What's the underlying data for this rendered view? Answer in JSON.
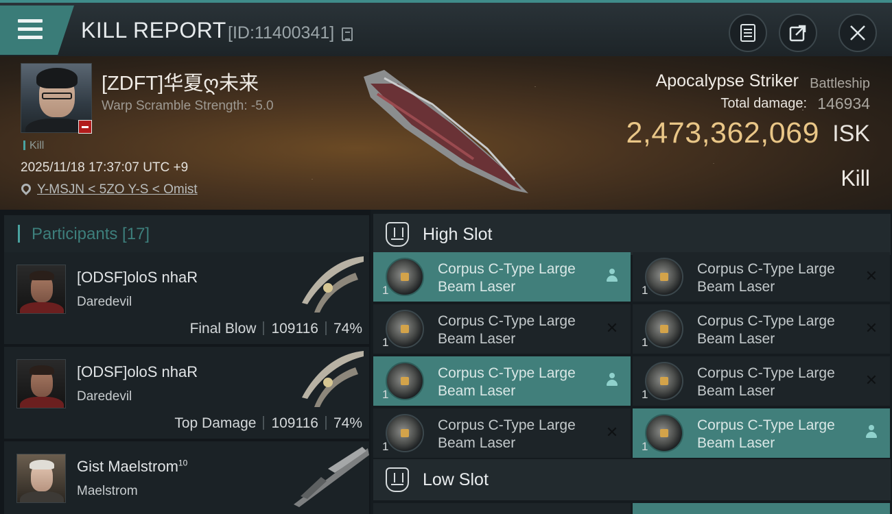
{
  "header": {
    "title": "KILL REPORT",
    "report_id": "[ID:11400341]"
  },
  "victim": {
    "name": "[ZDFT]华夏ღ未来",
    "warp_scramble": "Warp Scramble Strength: -5.0",
    "tag": "Kill",
    "datetime": "2025/11/18 17:37:07 UTC +9",
    "location": "Y-MSJN < 5ZO Y-S < Omist"
  },
  "ship": {
    "name": "Apocalypse Striker",
    "class": "Battleship",
    "total_damage_label": "Total damage:",
    "total_damage": "146934",
    "isk_value": "2,473,362,069",
    "isk_unit": "ISK",
    "result": "Kill"
  },
  "participants": {
    "title": "Participants [17]",
    "rows": [
      {
        "name": "[ODSF]oloS nhaR",
        "ship": "Daredevil",
        "role": "Final Blow",
        "damage": "109116",
        "percent": "74%"
      },
      {
        "name": "[ODSF]oloS nhaR",
        "ship": "Daredevil",
        "role": "Top Damage",
        "damage": "109116",
        "percent": "74%"
      },
      {
        "name": "Gist Maelstrom",
        "sup": "10",
        "ship": "Maelstrom"
      }
    ]
  },
  "slots": {
    "high_title": "High Slot",
    "low_title": "Low Slot",
    "modules": [
      {
        "qty": "1",
        "line1": "Corpus C-Type Large",
        "line2": "Beam Laser",
        "status": "dropped-person-icon"
      },
      {
        "qty": "1",
        "line1": "Corpus C-Type Large",
        "line2": "Beam Laser",
        "status": "destroyed-x-icon"
      },
      {
        "qty": "1",
        "line1": "Corpus C-Type Large",
        "line2": "Beam Laser",
        "status": "destroyed-x-icon"
      },
      {
        "qty": "1",
        "line1": "Corpus C-Type Large",
        "line2": "Beam Laser",
        "status": "destroyed-x-icon"
      },
      {
        "qty": "1",
        "line1": "Corpus C-Type Large",
        "line2": "Beam Laser",
        "status": "dropped-person-icon"
      },
      {
        "qty": "1",
        "line1": "Corpus C-Type Large",
        "line2": "Beam Laser",
        "status": "destroyed-x-icon"
      },
      {
        "qty": "1",
        "line1": "Corpus C-Type Large",
        "line2": "Beam Laser",
        "status": "destroyed-x-icon"
      },
      {
        "qty": "1",
        "line1": "Corpus C-Type Large",
        "line2": "Beam Laser",
        "status": "dropped-person-icon"
      }
    ]
  },
  "colors": {
    "accent": "#417f7b",
    "isk_gold": "#e9c687",
    "background": "#141a1f"
  }
}
